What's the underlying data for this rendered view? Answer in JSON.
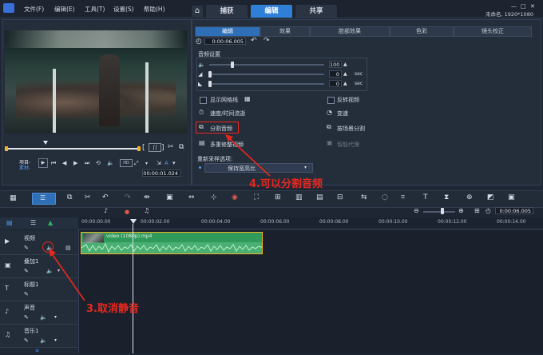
{
  "menu": [
    "文件(F)",
    "编辑(E)",
    "工具(T)",
    "设置(S)",
    "帮助(H)"
  ],
  "main_tabs": [
    "捕获",
    "编辑",
    "共享"
  ],
  "project_info": "未命名, 1920*1080",
  "preview": {
    "mode_labels": [
      "项目-",
      "素材-"
    ],
    "timecode": "00:00:01.024"
  },
  "options_tabs": [
    "编辑",
    "效果",
    "脸部效果",
    "色彩",
    "镜头校正"
  ],
  "duration": "0:00:06.005",
  "audio_settings": {
    "title": "音频设置",
    "volume": "100",
    "fade_in": "0",
    "fade_out": "0",
    "unit": "sec"
  },
  "options": {
    "show_grid": "显示网格线",
    "reverse_video": "反转视频",
    "speed_time": "速度/时间流逝",
    "variable_speed": "变速",
    "split_audio": "分割音频",
    "split_by_scene": "按场景分割",
    "multi_trim": "多重修整视频",
    "smart_proxy": "智能代理"
  },
  "resample": {
    "label": "重新采样选项:",
    "value": "保持宽高比"
  },
  "annotations": {
    "split_audio": "4.可以分割音频",
    "unmute": "3.取消静音"
  },
  "timeline": {
    "zoom_timecode": "0:00:06.005",
    "ruler": [
      "00:00:00.00",
      "00:00:02.00",
      "00:00:04.00",
      "00:00:06.00",
      "00:00:08.00",
      "00:00:10.00",
      "00:00:12.00",
      "00:00:14.00"
    ],
    "tracks": [
      "视频",
      "叠加1",
      "标题1",
      "声音",
      "音乐1"
    ],
    "clip_name": "video (1080p).mp4"
  },
  "colors": {
    "accent": "#2f7fd6",
    "annotation": "#e8281f",
    "clip": "#2f9a5a"
  }
}
